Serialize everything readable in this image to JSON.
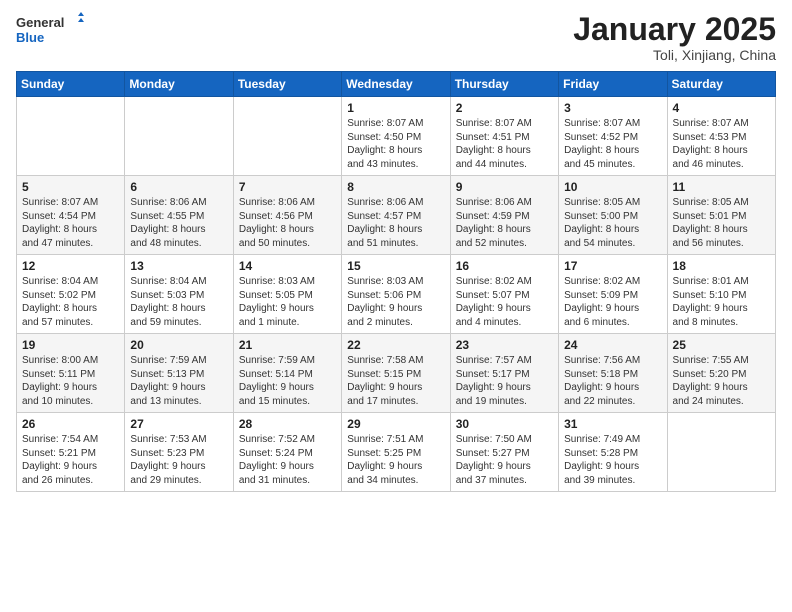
{
  "header": {
    "logo_general": "General",
    "logo_blue": "Blue",
    "title": "January 2025",
    "location": "Toli, Xinjiang, China"
  },
  "days_of_week": [
    "Sunday",
    "Monday",
    "Tuesday",
    "Wednesday",
    "Thursday",
    "Friday",
    "Saturday"
  ],
  "weeks": [
    [
      {
        "day": "",
        "info": ""
      },
      {
        "day": "",
        "info": ""
      },
      {
        "day": "",
        "info": ""
      },
      {
        "day": "1",
        "info": "Sunrise: 8:07 AM\nSunset: 4:50 PM\nDaylight: 8 hours\nand 43 minutes."
      },
      {
        "day": "2",
        "info": "Sunrise: 8:07 AM\nSunset: 4:51 PM\nDaylight: 8 hours\nand 44 minutes."
      },
      {
        "day": "3",
        "info": "Sunrise: 8:07 AM\nSunset: 4:52 PM\nDaylight: 8 hours\nand 45 minutes."
      },
      {
        "day": "4",
        "info": "Sunrise: 8:07 AM\nSunset: 4:53 PM\nDaylight: 8 hours\nand 46 minutes."
      }
    ],
    [
      {
        "day": "5",
        "info": "Sunrise: 8:07 AM\nSunset: 4:54 PM\nDaylight: 8 hours\nand 47 minutes."
      },
      {
        "day": "6",
        "info": "Sunrise: 8:06 AM\nSunset: 4:55 PM\nDaylight: 8 hours\nand 48 minutes."
      },
      {
        "day": "7",
        "info": "Sunrise: 8:06 AM\nSunset: 4:56 PM\nDaylight: 8 hours\nand 50 minutes."
      },
      {
        "day": "8",
        "info": "Sunrise: 8:06 AM\nSunset: 4:57 PM\nDaylight: 8 hours\nand 51 minutes."
      },
      {
        "day": "9",
        "info": "Sunrise: 8:06 AM\nSunset: 4:59 PM\nDaylight: 8 hours\nand 52 minutes."
      },
      {
        "day": "10",
        "info": "Sunrise: 8:05 AM\nSunset: 5:00 PM\nDaylight: 8 hours\nand 54 minutes."
      },
      {
        "day": "11",
        "info": "Sunrise: 8:05 AM\nSunset: 5:01 PM\nDaylight: 8 hours\nand 56 minutes."
      }
    ],
    [
      {
        "day": "12",
        "info": "Sunrise: 8:04 AM\nSunset: 5:02 PM\nDaylight: 8 hours\nand 57 minutes."
      },
      {
        "day": "13",
        "info": "Sunrise: 8:04 AM\nSunset: 5:03 PM\nDaylight: 8 hours\nand 59 minutes."
      },
      {
        "day": "14",
        "info": "Sunrise: 8:03 AM\nSunset: 5:05 PM\nDaylight: 9 hours\nand 1 minute."
      },
      {
        "day": "15",
        "info": "Sunrise: 8:03 AM\nSunset: 5:06 PM\nDaylight: 9 hours\nand 2 minutes."
      },
      {
        "day": "16",
        "info": "Sunrise: 8:02 AM\nSunset: 5:07 PM\nDaylight: 9 hours\nand 4 minutes."
      },
      {
        "day": "17",
        "info": "Sunrise: 8:02 AM\nSunset: 5:09 PM\nDaylight: 9 hours\nand 6 minutes."
      },
      {
        "day": "18",
        "info": "Sunrise: 8:01 AM\nSunset: 5:10 PM\nDaylight: 9 hours\nand 8 minutes."
      }
    ],
    [
      {
        "day": "19",
        "info": "Sunrise: 8:00 AM\nSunset: 5:11 PM\nDaylight: 9 hours\nand 10 minutes."
      },
      {
        "day": "20",
        "info": "Sunrise: 7:59 AM\nSunset: 5:13 PM\nDaylight: 9 hours\nand 13 minutes."
      },
      {
        "day": "21",
        "info": "Sunrise: 7:59 AM\nSunset: 5:14 PM\nDaylight: 9 hours\nand 15 minutes."
      },
      {
        "day": "22",
        "info": "Sunrise: 7:58 AM\nSunset: 5:15 PM\nDaylight: 9 hours\nand 17 minutes."
      },
      {
        "day": "23",
        "info": "Sunrise: 7:57 AM\nSunset: 5:17 PM\nDaylight: 9 hours\nand 19 minutes."
      },
      {
        "day": "24",
        "info": "Sunrise: 7:56 AM\nSunset: 5:18 PM\nDaylight: 9 hours\nand 22 minutes."
      },
      {
        "day": "25",
        "info": "Sunrise: 7:55 AM\nSunset: 5:20 PM\nDaylight: 9 hours\nand 24 minutes."
      }
    ],
    [
      {
        "day": "26",
        "info": "Sunrise: 7:54 AM\nSunset: 5:21 PM\nDaylight: 9 hours\nand 26 minutes."
      },
      {
        "day": "27",
        "info": "Sunrise: 7:53 AM\nSunset: 5:23 PM\nDaylight: 9 hours\nand 29 minutes."
      },
      {
        "day": "28",
        "info": "Sunrise: 7:52 AM\nSunset: 5:24 PM\nDaylight: 9 hours\nand 31 minutes."
      },
      {
        "day": "29",
        "info": "Sunrise: 7:51 AM\nSunset: 5:25 PM\nDaylight: 9 hours\nand 34 minutes."
      },
      {
        "day": "30",
        "info": "Sunrise: 7:50 AM\nSunset: 5:27 PM\nDaylight: 9 hours\nand 37 minutes."
      },
      {
        "day": "31",
        "info": "Sunrise: 7:49 AM\nSunset: 5:28 PM\nDaylight: 9 hours\nand 39 minutes."
      },
      {
        "day": "",
        "info": ""
      }
    ]
  ]
}
